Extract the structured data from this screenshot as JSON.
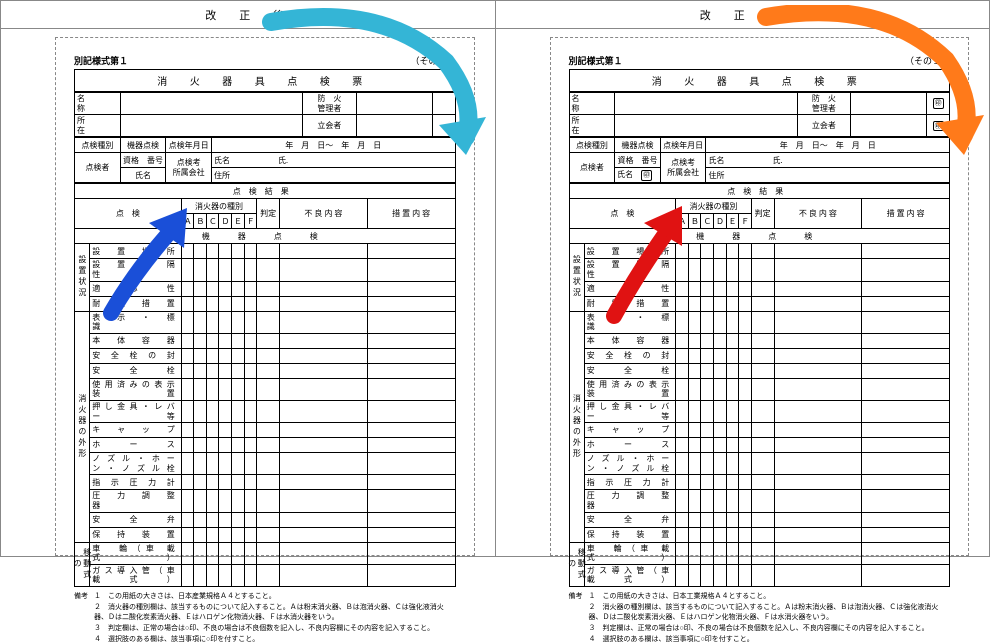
{
  "panes": {
    "left": {
      "header": "改　正　後"
    },
    "right": {
      "header": "改　正　前"
    }
  },
  "form_id": "別記様式第１",
  "sono": "（その１）",
  "title": "消 火 器 具 点 検 票",
  "upper": {
    "name_lbl": "名　称",
    "addr_lbl": "所　在",
    "mgr_lbl": "防　火\n管理者",
    "witness_lbl": "立会者",
    "stamp": "㊞"
  },
  "mid": {
    "type_lbl": "点検種別",
    "kiki_lbl": "機器点検",
    "date_lbl": "点検年月日",
    "date_val": "年　月　日～　年　月　日",
    "inspector_lbl": "点検者",
    "qual_lbl": "資格　番号",
    "name2_lbl": "氏名",
    "remarks_lbl": "点検考\n所属会社",
    "shimei_lbl": "氏名",
    "shimei_val": "氏.",
    "addr2_lbl": "住所"
  },
  "res": {
    "lbl": "点検結果",
    "tenken_lbl": "点　検",
    "type2_lbl": "消火器の種別",
    "cols": "Ａ Ｂ Ｃ Ｄ Ｅ Ｆ",
    "hantei": "判定",
    "furyou": "不 良 内 容",
    "sochi": "措 置 内 容",
    "kigu": "機　器　点　検"
  },
  "rows": {
    "set_v": "設置状況",
    "r1": "設　置　場　所",
    "r2": "設　置　間　隔　性",
    "r3": "適　応　性",
    "r4": "耐　震　措　置",
    "shou_v": "消火器の外形",
    "r5": "表　示　・　標　識",
    "r6": "本　体　容　器",
    "r7": "安 全 栓 の 封",
    "r8": "安　全　栓",
    "r9": "使用済みの表示装置",
    "r10": "押し金具・レバー等",
    "r11": "キ　ャ　ッ　プ",
    "r12": "ホ　ー　ス",
    "r13": "ノズル・ホーン・ノズル栓",
    "r14": "指 示 圧 力 計",
    "r15": "圧　力　調　整　器",
    "r16": "安　全　弁",
    "r17": "保　持　装　置",
    "i_v": "移動式の",
    "r18": "車　輪（車 載 式）",
    "r19": "ガス導入管（車載式）"
  },
  "notes": {
    "biko": "備考",
    "n1": "１　この用紙の大きさは、日本産業規格Ａ４とすること。",
    "n1r": "１　この用紙の大きさは、日本工業規格Ａ４とすること。",
    "n2": "２　消火器の種別欄は、該当するものについて記入すること。Ａは粉末消火器、Ｂは泡消火器、Ｃは強化液消火器、Ｄは二酸化炭素消火器、Ｅはハロゲン化物消火器、Ｆは水消火器をいう。",
    "n3": "３　判定欄は、正常の場合は○印、不良の場合は不良個数を記入し、不良内容欄にその内容を記入すること。",
    "n4": "４　選択肢のある欄は、該当事項に○印を付すこと。"
  }
}
